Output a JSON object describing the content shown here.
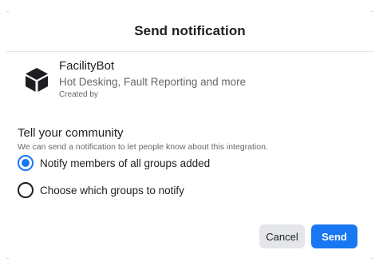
{
  "dialog": {
    "title": "Send notification"
  },
  "app": {
    "name": "FacilityBot",
    "description": "Hot Desking, Fault Reporting and more",
    "created_by": "Created by",
    "icon": "cube-icon"
  },
  "community": {
    "heading": "Tell your community",
    "description": "We can send a notification to let people know about this integration."
  },
  "options": [
    {
      "label": "Notify members of all groups added",
      "selected": true
    },
    {
      "label": "Choose which groups to notify",
      "selected": false
    }
  ],
  "actions": {
    "cancel_label": "Cancel",
    "send_label": "Send"
  },
  "colors": {
    "accent": "#1877f2",
    "secondary_button": "#e4e6eb",
    "muted_text": "#65676b"
  }
}
